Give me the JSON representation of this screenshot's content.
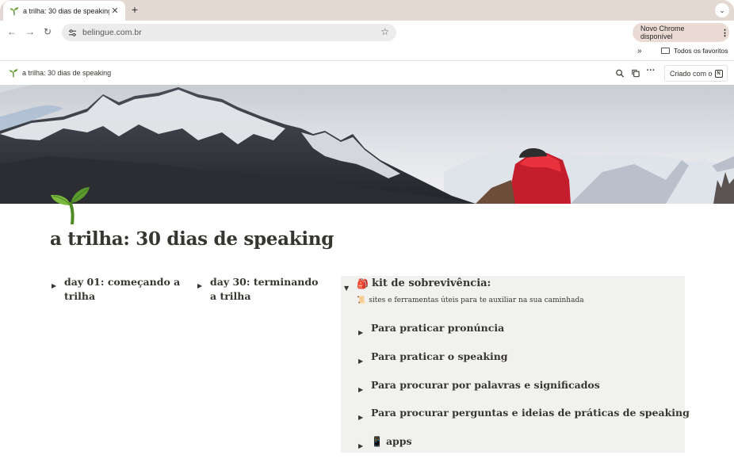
{
  "browser": {
    "tab_title": "a trilha: 30 dias de speaking",
    "tab_close": "✕",
    "new_tab": "+",
    "tab_menu": "⌄",
    "back": "←",
    "forward": "→",
    "reload": "↻",
    "url": "belingue.com.br",
    "bookmark_star": "☆",
    "update_label": "Novo Chrome disponível",
    "update_menu": "⋮",
    "bookmarks_more": "»",
    "bookmarks_folder": "Todos os favoritos"
  },
  "notion_header": {
    "breadcrumb": "a trilha: 30 dias de speaking",
    "search_glyph": "⌕",
    "duplicate_glyph": "⧉",
    "more_glyph": "···",
    "created_label": "Criado com o",
    "notion_logo_letter": "N"
  },
  "page": {
    "title": "a trilha: 30 dias de speaking",
    "toggle_glyph": "▶",
    "toggle_open_glyph": "▼",
    "day01": "day 01: começando a trilha",
    "day30": "day 30: terminando a trilha",
    "kit": {
      "emoji": "🎒",
      "title": "kit de sobrevivência:",
      "subtitle_emoji": "📜",
      "subtitle": "sites e ferramentas úteis para te auxiliar na sua caminhada",
      "items": [
        {
          "label": "Para praticar pronúncia"
        },
        {
          "label": "Para praticar o speaking"
        },
        {
          "label": "Para procurar por palavras e significados"
        },
        {
          "label": "Para procurar perguntas e ideias de práticas de speaking"
        },
        {
          "label": "apps",
          "emoji": "📱"
        }
      ]
    }
  },
  "colors": {
    "tabstrip": "#e4d8d2",
    "text": "#37352f",
    "callout_bg": "#f1f1ef",
    "sprout_green": "#5c9a2e"
  },
  "icons": {
    "page": "sprout-icon",
    "backpack": "backpack-icon",
    "phone": "mobile-phone-icon"
  }
}
